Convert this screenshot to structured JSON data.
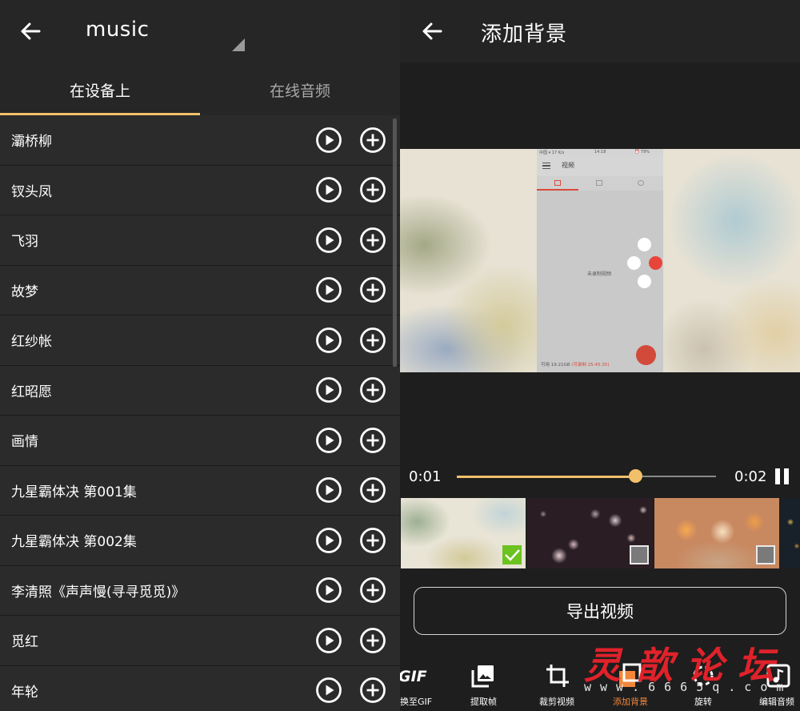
{
  "left_panel": {
    "title": "music",
    "tabs": [
      {
        "label": "在设备上",
        "active": true
      },
      {
        "label": "在线音频",
        "active": false
      }
    ],
    "accent_color": "#f2c06b",
    "songs": [
      "灞桥柳",
      "钗头凤",
      "飞羽",
      "故梦",
      "红纱帐",
      "红昭愿",
      "画情",
      "九星霸体决 第001集",
      "九星霸体决 第002集",
      "李清照《声声慢(寻寻觅觅)》",
      "觅红",
      "年轮"
    ],
    "row_icons": {
      "play": "play-circle-icon",
      "add": "add-circle-icon"
    }
  },
  "right_panel": {
    "title": "添加背景",
    "preview": {
      "status_left": "中国 ▾ 17 K/s",
      "status_time": "14:18",
      "status_right": "⏰ 79%",
      "app_title": "视频",
      "empty_text": "未录制视频",
      "bottom_left": "可用 19.21GB",
      "bottom_right": "(可录制 25:45:35)"
    },
    "player": {
      "current": "0:01",
      "total": "0:02",
      "progress": 0.69
    },
    "backgrounds": [
      {
        "name": "soft-blur",
        "selected": true
      },
      {
        "name": "pink-bokeh",
        "selected": false
      },
      {
        "name": "orange-bokeh",
        "selected": false
      },
      {
        "name": "dark-bokeh",
        "selected": false
      }
    ],
    "export_label": "导出视频",
    "tools": [
      {
        "label": "换至GIF",
        "icon": "gif-icon",
        "active": false,
        "icon_text": "GIF"
      },
      {
        "label": "提取帧",
        "icon": "image-icon",
        "active": false
      },
      {
        "label": "裁剪视频",
        "icon": "crop-icon",
        "active": false
      },
      {
        "label": "添加背景",
        "icon": "add-background-icon",
        "active": true
      },
      {
        "label": "旋转",
        "icon": "rotate-icon",
        "active": false
      },
      {
        "label": "编辑音频",
        "icon": "music-note-icon",
        "active": false
      }
    ],
    "active_color": "#f2873a"
  },
  "watermark": {
    "chars": [
      "灵",
      "歆",
      "论",
      "坛"
    ],
    "url": "www.6665q.com"
  }
}
